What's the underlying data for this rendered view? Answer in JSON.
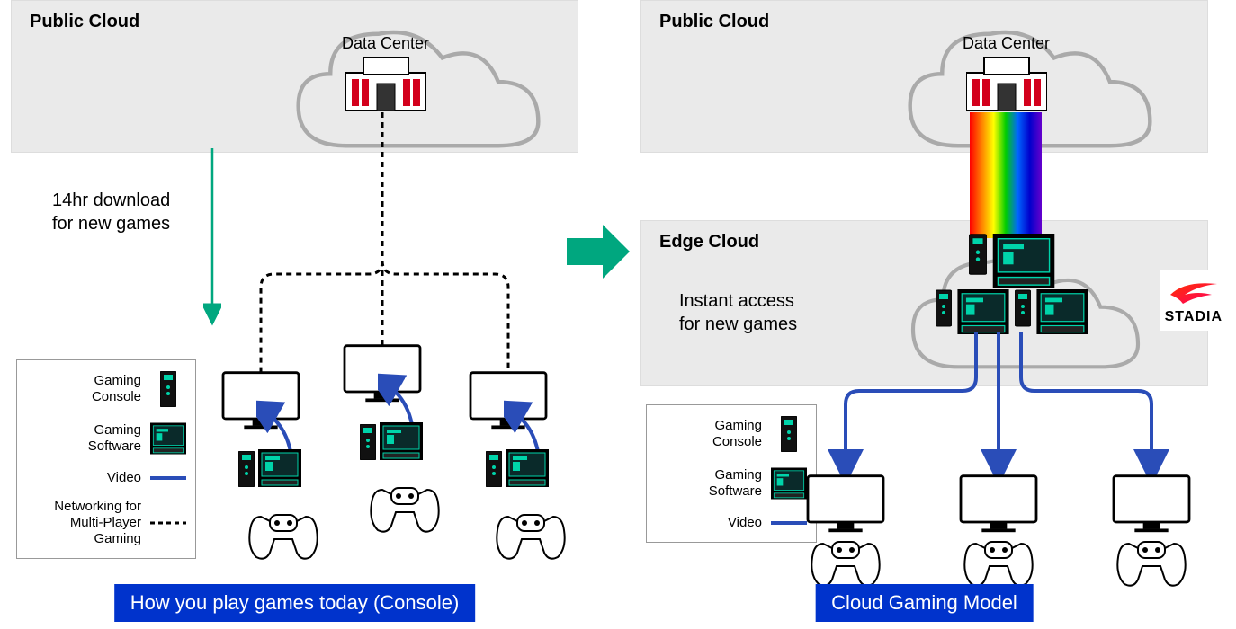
{
  "left": {
    "zone_public": "Public Cloud",
    "dc_label": "Data Center",
    "note": "14hr download\nfor new games",
    "legend": {
      "console": "Gaming Console",
      "software": "Gaming Software",
      "video": "Video",
      "net": "Networking for Multi-Player Gaming"
    },
    "caption": "How you play games today (Console)"
  },
  "right": {
    "zone_public": "Public Cloud",
    "zone_edge": "Edge Cloud",
    "dc_label": "Data Center",
    "note": "Instant access\nfor new games",
    "legend": {
      "console": "Gaming Console",
      "software": "Gaming Software",
      "video": "Video"
    },
    "brand": "STADIA",
    "caption": "Cloud Gaming Model"
  },
  "colors": {
    "teal": "#00a77f",
    "blue": "#2a4db8",
    "red": "#d3001c"
  }
}
